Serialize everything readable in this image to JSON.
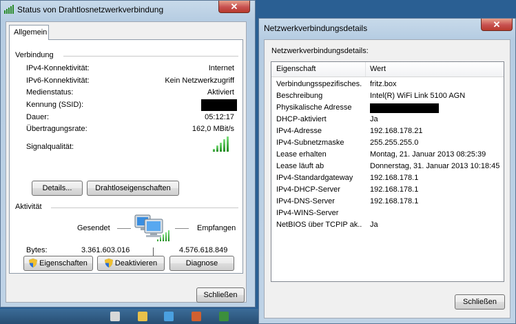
{
  "status_window": {
    "title": "Status von Drahtlosnetzwerkverbindung",
    "tab": "Allgemein",
    "connection": {
      "group_label": "Verbindung",
      "rows": [
        {
          "label": "IPv4-Konnektivität:",
          "value": "Internet"
        },
        {
          "label": "IPv6-Konnektivität:",
          "value": "Kein Netzwerkzugriff"
        },
        {
          "label": "Medienstatus:",
          "value": "Aktiviert"
        },
        {
          "label": "Kennung (SSID):",
          "value": ""
        },
        {
          "label": "Dauer:",
          "value": "05:12:17"
        },
        {
          "label": "Übertragungsrate:",
          "value": "162,0 MBit/s"
        }
      ],
      "signal_label": "Signalqualität:",
      "signal_bars_filled": 5,
      "signal_bars_total": 5,
      "details_button": "Details...",
      "wireless_props_button": "Drahtloseigenschaften"
    },
    "activity": {
      "group_label": "Aktivität",
      "sent_label": "Gesendet",
      "received_label": "Empfangen",
      "bytes_label": "Bytes:",
      "bytes_sent": "3.361.603.016",
      "bytes_received": "4.576.618.849"
    },
    "buttons": {
      "properties": "Eigenschaften",
      "deactivate": "Deaktivieren",
      "diagnose": "Diagnose"
    },
    "close_button": "Schließen"
  },
  "details_window": {
    "title": "Netzwerkverbindungsdetails",
    "label": "Netzwerkverbindungsdetails:",
    "columns": [
      "Eigenschaft",
      "Wert"
    ],
    "rows": [
      {
        "property": "Verbindungsspezifisches...",
        "value": "fritz.box"
      },
      {
        "property": "Beschreibung",
        "value": "Intel(R) WiFi Link 5100 AGN"
      },
      {
        "property": "Physikalische Adresse",
        "value": ""
      },
      {
        "property": "DHCP-aktiviert",
        "value": "Ja"
      },
      {
        "property": "IPv4-Adresse",
        "value": "192.168.178.21"
      },
      {
        "property": "IPv4-Subnetzmaske",
        "value": "255.255.255.0"
      },
      {
        "property": "Lease erhalten",
        "value": "Montag, 21. Januar 2013 08:25:39"
      },
      {
        "property": "Lease läuft ab",
        "value": "Donnerstag, 31. Januar 2013 10:18:45"
      },
      {
        "property": "IPv4-Standardgateway",
        "value": "192.168.178.1"
      },
      {
        "property": "IPv4-DHCP-Server",
        "value": "192.168.178.1"
      },
      {
        "property": "IPv4-DNS-Server",
        "value": "192.168.178.1"
      },
      {
        "property": "IPv4-WINS-Server",
        "value": ""
      },
      {
        "property": "NetBIOS über TCPIP ak...",
        "value": "Ja"
      }
    ],
    "close_button": "Schließen"
  },
  "colors": {
    "desktop": "#2a5f93",
    "close_red": "#c75050",
    "signal_green": "#1c8a1c"
  }
}
